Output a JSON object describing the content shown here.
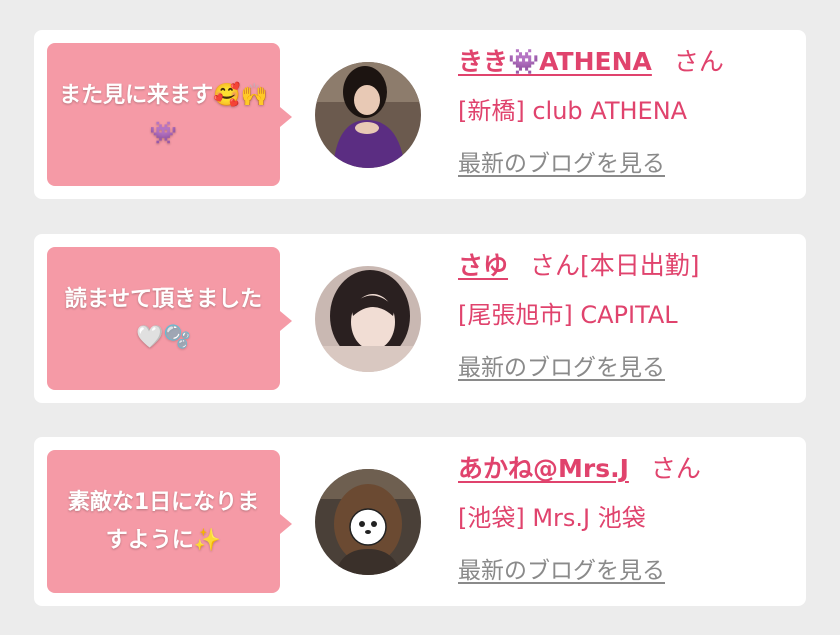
{
  "cards": [
    {
      "bubble": "また見に来ます🥰🙌👾",
      "name": "きき👾ATHENA",
      "honorific": "さん",
      "extra": "",
      "shop": "[新橋] club ATHENA",
      "blog_link": "最新のブログを見る"
    },
    {
      "bubble": "読ませて頂きました🤍🫧",
      "name": "さゆ",
      "honorific": "さん",
      "extra": "[本日出勤]",
      "shop": "[尾張旭市] CAPITAL",
      "blog_link": "最新のブログを見る"
    },
    {
      "bubble": "素敵な1日になりますように✨",
      "name": "あかね@Mrs.J",
      "honorific": "さん",
      "extra": "",
      "shop": "[池袋] Mrs.J 池袋",
      "blog_link": "最新のブログを見る"
    }
  ],
  "colors": {
    "accent": "#e0436d",
    "bubble": "#f59aa6",
    "link_gray": "#8a8a8a",
    "background": "#ececec"
  }
}
